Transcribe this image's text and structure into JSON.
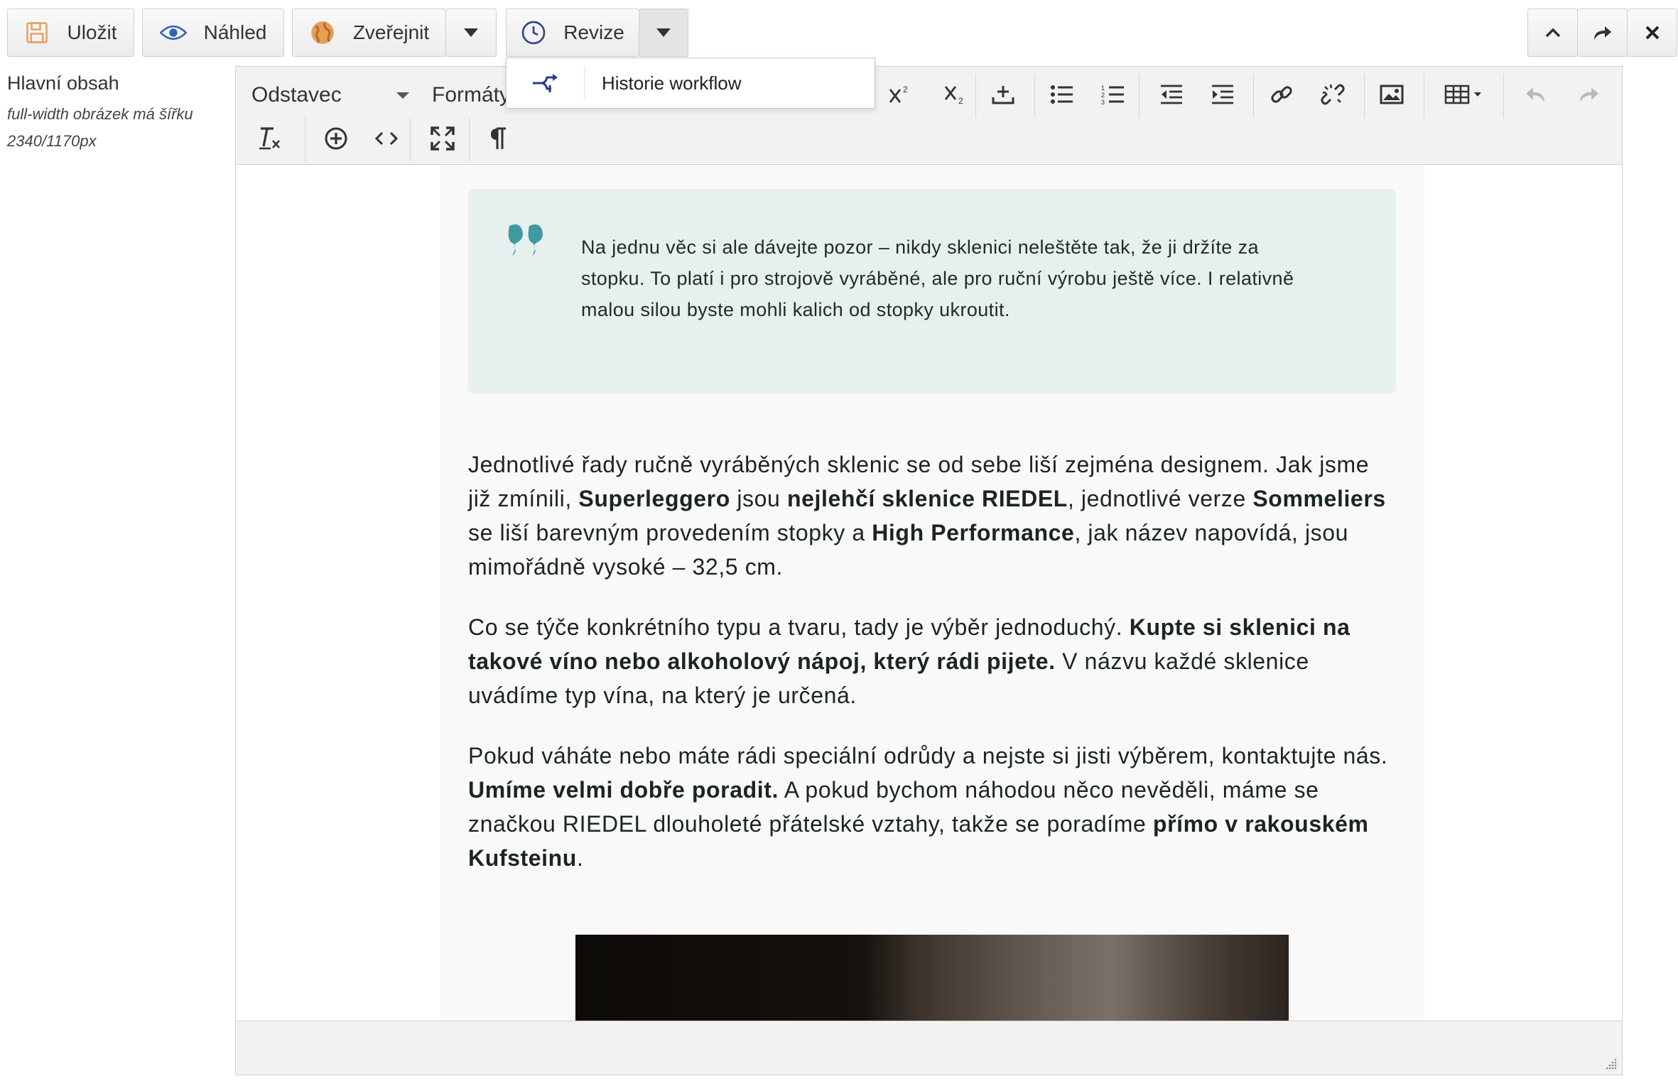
{
  "toolbar": {
    "save_label": "Uložit",
    "preview_label": "Náhled",
    "publish_label": "Zveřejnit",
    "revision_label": "Revize"
  },
  "revision_menu": {
    "items": [
      {
        "label": "Historie workflow",
        "icon": "workflow-icon"
      }
    ]
  },
  "sidebar_meta": {
    "field_title": "Hlavní obsah",
    "hint_line1": "full-width obrázek má šířku",
    "hint_line2": "2340/1170px"
  },
  "editor": {
    "block_format": "Odstavec",
    "formats_label": "Formáty",
    "quote_text": "Na jednu věc si ale dávejte pozor – nikdy sklenici neleštěte tak, že ji držíte za stopku. To platí i pro strojově vyráběné, ale pro ruční výrobu ještě více. I relativně malou silou byste mohli kalich od stopky ukroutit.",
    "paragraphs": [
      {
        "t1": "Jednotlivé řady ručně vyráběných sklenic se od sebe liší zejména designem. Jak jsme již zmínili, ",
        "b1": "Superleggero",
        "t2": " jsou ",
        "b2": "nejlehčí sklenice RIEDEL",
        "t3": ", jednotlivé verze ",
        "b3": "Sommeliers",
        "t4": " se liší barevným provedením stopky a ",
        "b4": "High Performance",
        "t5": ", jak název napovídá, jsou mimořádně vysoké – 32,5 cm."
      },
      {
        "t1": "Co se týče konkrétního typu a tvaru, tady je výběr jednoduchý. ",
        "b1": "Kupte si sklenici na takové víno nebo alkoholový nápoj, který rádi pijete.",
        "t2": " V názvu každé sklenice uvádíme typ vína, na který je určená."
      },
      {
        "t1": "Pokud váháte nebo máte rádi speciální odrůdy a nejste si jisti výběrem, kontaktujte nás. ",
        "b1": "Umíme velmi dobře poradit.",
        "t2": " A pokud bychom náhodou něco nevěděli, máme se značkou RIEDEL dlouholeté přátelské vztahy, takže se poradíme ",
        "b2": "přímo v rakouském Kufsteinu",
        "t3": "."
      }
    ]
  },
  "colors": {
    "accent_quote": "#3f9aa0",
    "save_icon": "#e0a060",
    "preview_icon": "#2f63b5",
    "revision_icon": "#2c4a8a",
    "workflow_icon": "#2b3a8e"
  }
}
